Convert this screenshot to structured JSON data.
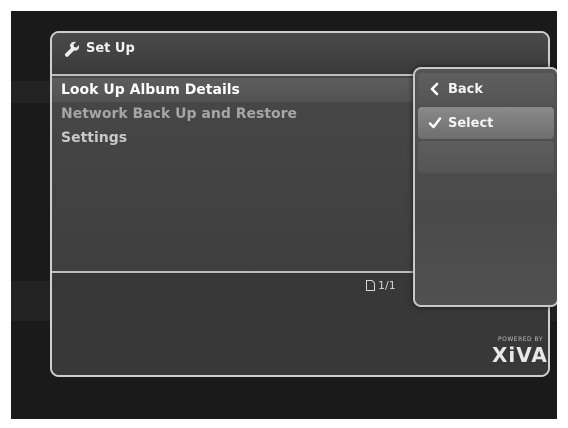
{
  "window": {
    "title": "Set Up",
    "title_icon": "wrench-icon"
  },
  "list": {
    "items": [
      {
        "label": "Look Up Album Details",
        "state": "selected"
      },
      {
        "label": "Network Back Up and Restore",
        "state": "dim"
      },
      {
        "label": "Settings",
        "state": "normal"
      }
    ]
  },
  "pager": {
    "icon": "page-icon",
    "text": "1/1"
  },
  "branding": {
    "powered_by": "POWERED BY",
    "logo": "XiVA"
  },
  "context_menu": {
    "items": [
      {
        "label": "Back",
        "icon": "chevron-left-icon"
      },
      {
        "label": "Select",
        "icon": "checkmark-icon"
      },
      {
        "label": "",
        "icon": ""
      }
    ]
  },
  "colors": {
    "window_border": "#cfcfcf",
    "background": "#1a1a1a",
    "selected_row": "#5d5d5d",
    "menu_highlight": "#8a8a8a"
  }
}
